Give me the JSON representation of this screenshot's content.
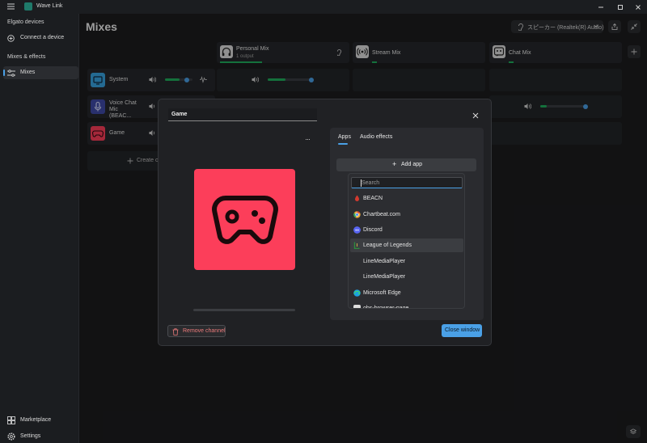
{
  "window": {
    "title": "Wave Link"
  },
  "sidebar": {
    "devices_header": "Elgato devices",
    "connect_label": "Connect a device",
    "mixes_header": "Mixes & effects",
    "mixes_label": "Mixes",
    "marketplace_label": "Marketplace",
    "settings_label": "Settings"
  },
  "main": {
    "title": "Mixes",
    "output_device": "スピーカー (Realtek(R) Audio)",
    "mixes": [
      {
        "name": "Personal Mix",
        "sub": "1 output"
      },
      {
        "name": "Stream Mix",
        "sub": ""
      },
      {
        "name": "Chat Mix",
        "sub": ""
      }
    ],
    "channels": [
      {
        "name": "System",
        "level": 0.55
      },
      {
        "name": "Voice Chat Mic (BEAC...",
        "level": 0.2
      },
      {
        "name": "Game",
        "level": 0.0
      }
    ],
    "personal_system_level": 0.6,
    "chat_voice_level": 0.15,
    "create_label": "Create c"
  },
  "dialog": {
    "title": "Game",
    "more": "···",
    "remove_label": "Remove channel",
    "close_label": "Close window",
    "tabs": [
      "Apps",
      "Audio effects"
    ],
    "add_app_label": "Add app",
    "search_placeholder": "Search",
    "apps": [
      {
        "name": "BEACN",
        "color": "#c0392b"
      },
      {
        "name": "Chartbeat.com",
        "color": "#e9a53a"
      },
      {
        "name": "Discord",
        "color": "#5865f2"
      },
      {
        "name": "League of Legends",
        "color": "#2e8b3e"
      },
      {
        "name": "LineMediaPlayer",
        "color": ""
      },
      {
        "name": "LineMediaPlayer",
        "color": ""
      },
      {
        "name": "Microsoft Edge",
        "color": "#1ba1e2"
      },
      {
        "name": "obs-browser-page",
        "color": "#dddddd"
      }
    ]
  },
  "colors": {
    "accent": "#4aa0e6",
    "green": "#1fae5c",
    "game_tile": "#fc3e5a",
    "remove_text": "#ec7b7b"
  }
}
